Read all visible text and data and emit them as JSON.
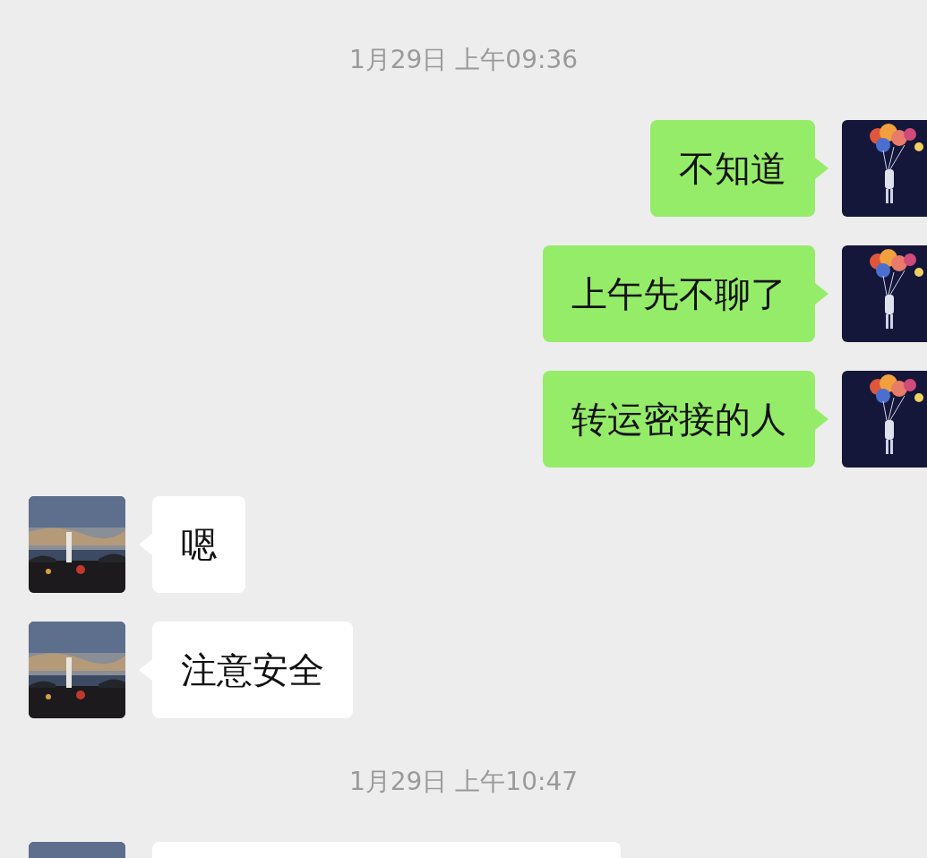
{
  "messages": [
    {
      "kind": "time",
      "text": "1月29日 上午09:36"
    },
    {
      "kind": "out",
      "text": "不知道"
    },
    {
      "kind": "out",
      "text": "上午先不聊了"
    },
    {
      "kind": "out",
      "text": "转运密接的人"
    },
    {
      "kind": "in",
      "text": "嗯"
    },
    {
      "kind": "in",
      "text": "注意安全"
    },
    {
      "kind": "time",
      "text": "1月29日 上午10:47"
    },
    {
      "kind": "in"
    }
  ]
}
